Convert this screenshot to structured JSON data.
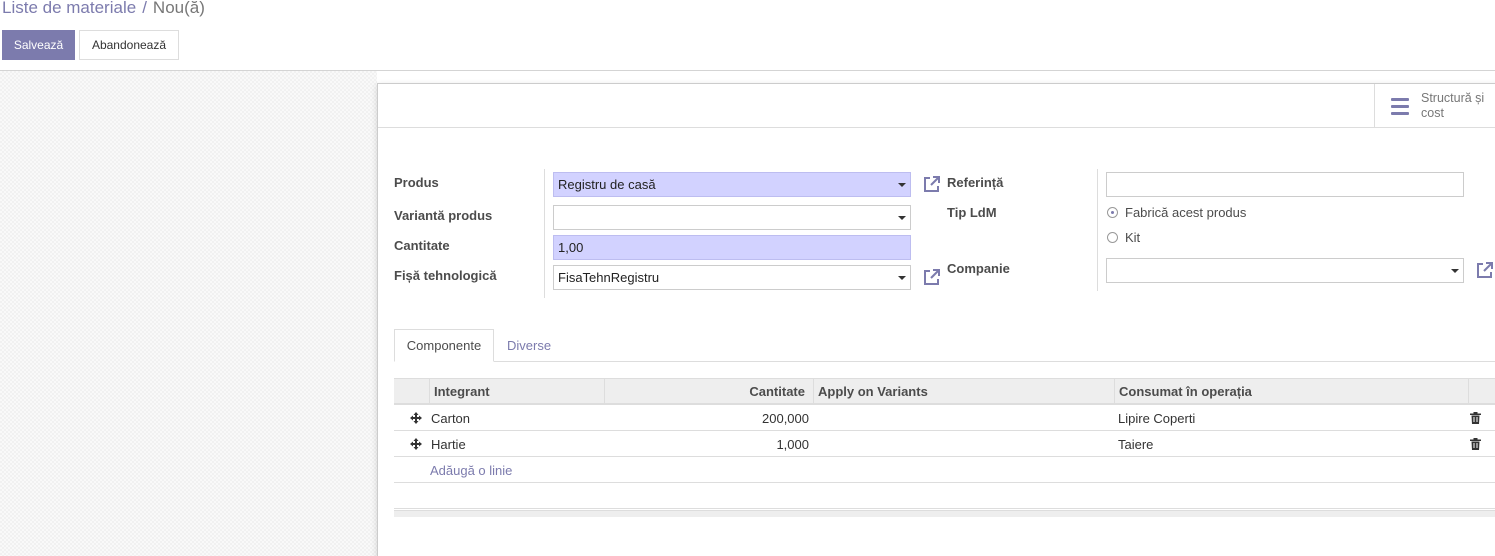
{
  "breadcrumb": {
    "parent": "Liste de materiale",
    "separator": "/",
    "current": "Nou(ă)"
  },
  "buttons": {
    "save": "Salvează",
    "discard": "Abandonează"
  },
  "stat_button": {
    "label": "Structură și cost"
  },
  "form": {
    "product": {
      "label": "Produs",
      "value": "Registru de casă"
    },
    "variant": {
      "label": "Variantă produs",
      "value": ""
    },
    "quantity": {
      "label": "Cantitate",
      "value": "1,00"
    },
    "routing": {
      "label": "Fișă tehnologică",
      "value": "FisaTehnRegistru"
    },
    "reference": {
      "label": "Referință",
      "value": ""
    },
    "bom_type": {
      "label": "Tip LdM",
      "options": [
        "Fabrică acest produs",
        "Kit"
      ],
      "selected": 0
    },
    "company": {
      "label": "Companie",
      "value": ""
    }
  },
  "tabs": [
    {
      "label": "Componente",
      "active": true
    },
    {
      "label": "Diverse",
      "active": false
    }
  ],
  "table": {
    "columns": [
      "Integrant",
      "Cantitate",
      "Apply on Variants",
      "Consumat în operația"
    ],
    "rows": [
      {
        "product": "Carton",
        "quantity": "200,000",
        "variants": "",
        "operation": "Lipire Coperti"
      },
      {
        "product": "Hartie",
        "quantity": "1,000",
        "variants": "",
        "operation": "Taiere"
      }
    ],
    "add_line": "Adăugă o linie"
  },
  "colors": {
    "accent": "#7c7bad",
    "required_bg": "#d2d2ff"
  },
  "icons": {
    "stat": "list-icon",
    "external": "external-link-icon",
    "handle": "drag-handle-icon",
    "delete": "trash-icon",
    "dropdown": "caret-down-icon"
  }
}
